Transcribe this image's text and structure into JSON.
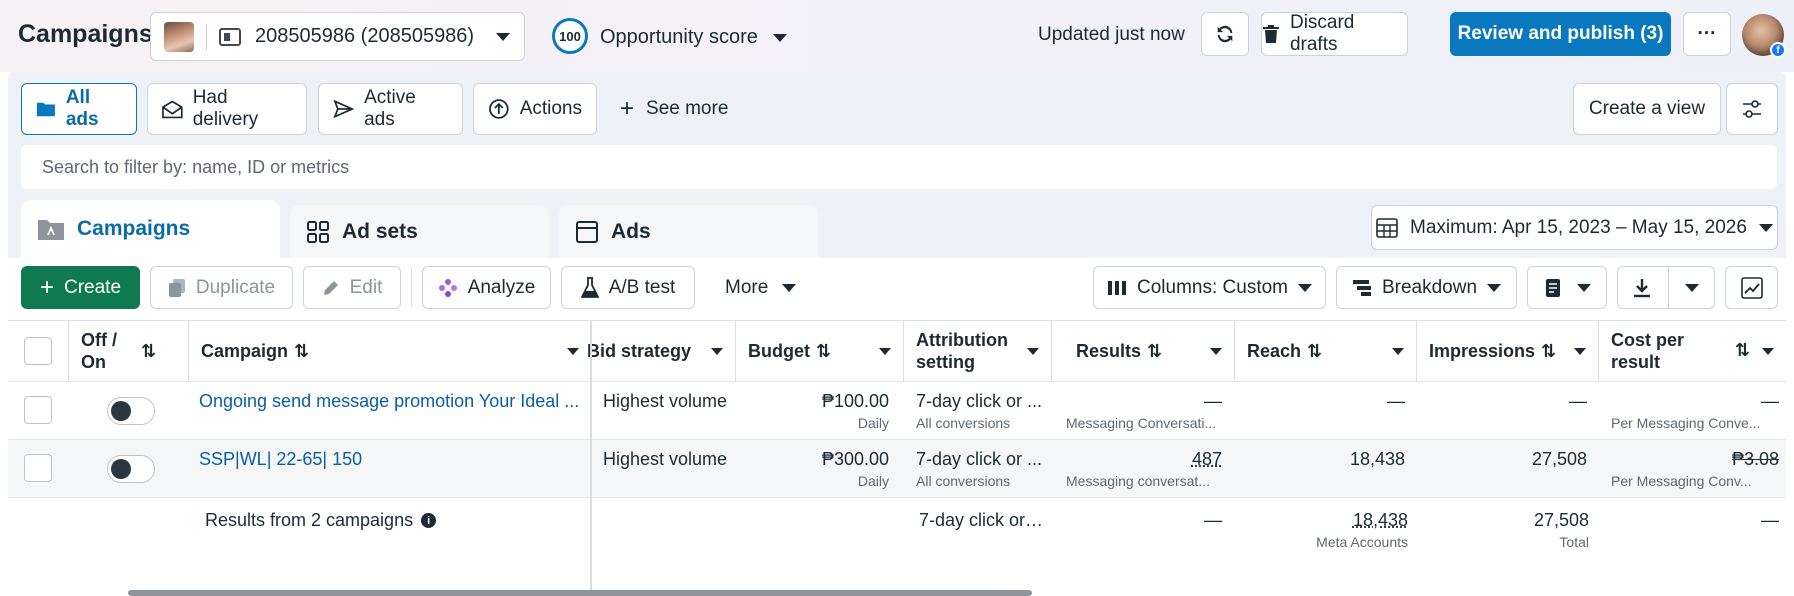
{
  "app": {
    "title": "Campaigns"
  },
  "account": {
    "label": "208505986 (208505986)"
  },
  "opportunity": {
    "score": "100",
    "label": "Opportunity score"
  },
  "header": {
    "updated": "Updated just now",
    "discard": "Discard drafts",
    "review": "Review and publish (3)",
    "more": "···",
    "badge": "f"
  },
  "filters": {
    "all_ads": "All ads",
    "had_delivery": "Had delivery",
    "active_ads": "Active ads",
    "actions": "Actions",
    "see_more": "See more",
    "create_view": "Create a view"
  },
  "search": {
    "placeholder": "Search to filter by: name, ID or metrics"
  },
  "tabs": {
    "campaigns": "Campaigns",
    "ad_sets": "Ad sets",
    "ads": "Ads"
  },
  "date_range": "Maximum: Apr 15, 2023 – May 15, 2026",
  "toolbar": {
    "create": "Create",
    "duplicate": "Duplicate",
    "edit": "Edit",
    "analyze": "Analyze",
    "ab_test": "A/B test",
    "more": "More",
    "columns": "Columns: Custom",
    "breakdown": "Breakdown"
  },
  "table": {
    "headers": {
      "off_on": "Off / On",
      "campaign": "Campaign",
      "bid": "Bid strategy",
      "budget": "Budget",
      "attribution": "Attribution setting",
      "results": "Results",
      "reach": "Reach",
      "impressions": "Impressions",
      "cost": "Cost per result"
    },
    "rows": [
      {
        "campaign": "Ongoing send message promotion Your Ideal ...",
        "bid": "Highest volume",
        "budget": "₱100.00",
        "budget_sub": "Daily",
        "attribution": "7-day click or ...",
        "attribution_sub": "All conversions",
        "results": "—",
        "results_sub": "Messaging Conversati...",
        "reach": "—",
        "impressions": "—",
        "cost": "—",
        "cost_sub": "Per Messaging Conve..."
      },
      {
        "campaign": "SSP|WL| 22-65| 150",
        "bid": "Highest volume",
        "budget": "₱300.00",
        "budget_sub": "Daily",
        "attribution": "7-day click or ...",
        "attribution_sub": "All conversions",
        "results": "487",
        "results_sub": "Messaging conversat...",
        "reach": "18,438",
        "impressions": "27,508",
        "cost": "₱3.08",
        "cost_sub": "Per Messaging Conv..."
      }
    ],
    "summary": {
      "label": "Results from 2 campaigns",
      "attribution": "7-day click or ...",
      "results": "—",
      "reach": "18,438",
      "reach_sub": "Meta Accounts",
      "impressions": "27,508",
      "impressions_sub": "Total",
      "cost": "—"
    }
  }
}
